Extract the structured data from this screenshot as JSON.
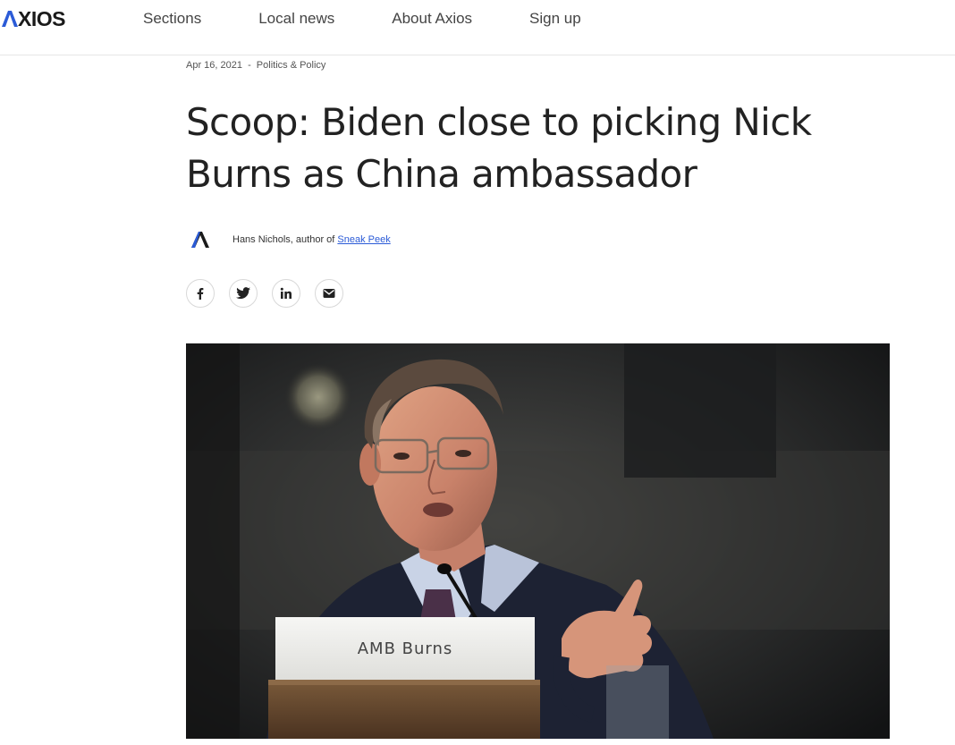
{
  "header": {
    "logo_text": "XIOS",
    "nav": [
      {
        "label": "Sections"
      },
      {
        "label": "Local news"
      },
      {
        "label": "About Axios"
      },
      {
        "label": "Sign up"
      }
    ]
  },
  "article": {
    "date": "Apr 16, 2021",
    "separator": "-",
    "category": "Politics & Policy",
    "headline": "Scoop: Biden close to picking Nick Burns as China ambassador",
    "byline": {
      "author_prefix": "Hans Nichols, author of ",
      "newsletter_link": "Sneak Peek"
    },
    "share_icons": [
      "facebook-icon",
      "twitter-icon",
      "linkedin-icon",
      "email-icon"
    ],
    "photo": {
      "placard_text": "AMB Burns"
    }
  },
  "colors": {
    "brand_blue": "#2b5bd7",
    "text": "#222222",
    "link": "#2b5bd7"
  }
}
